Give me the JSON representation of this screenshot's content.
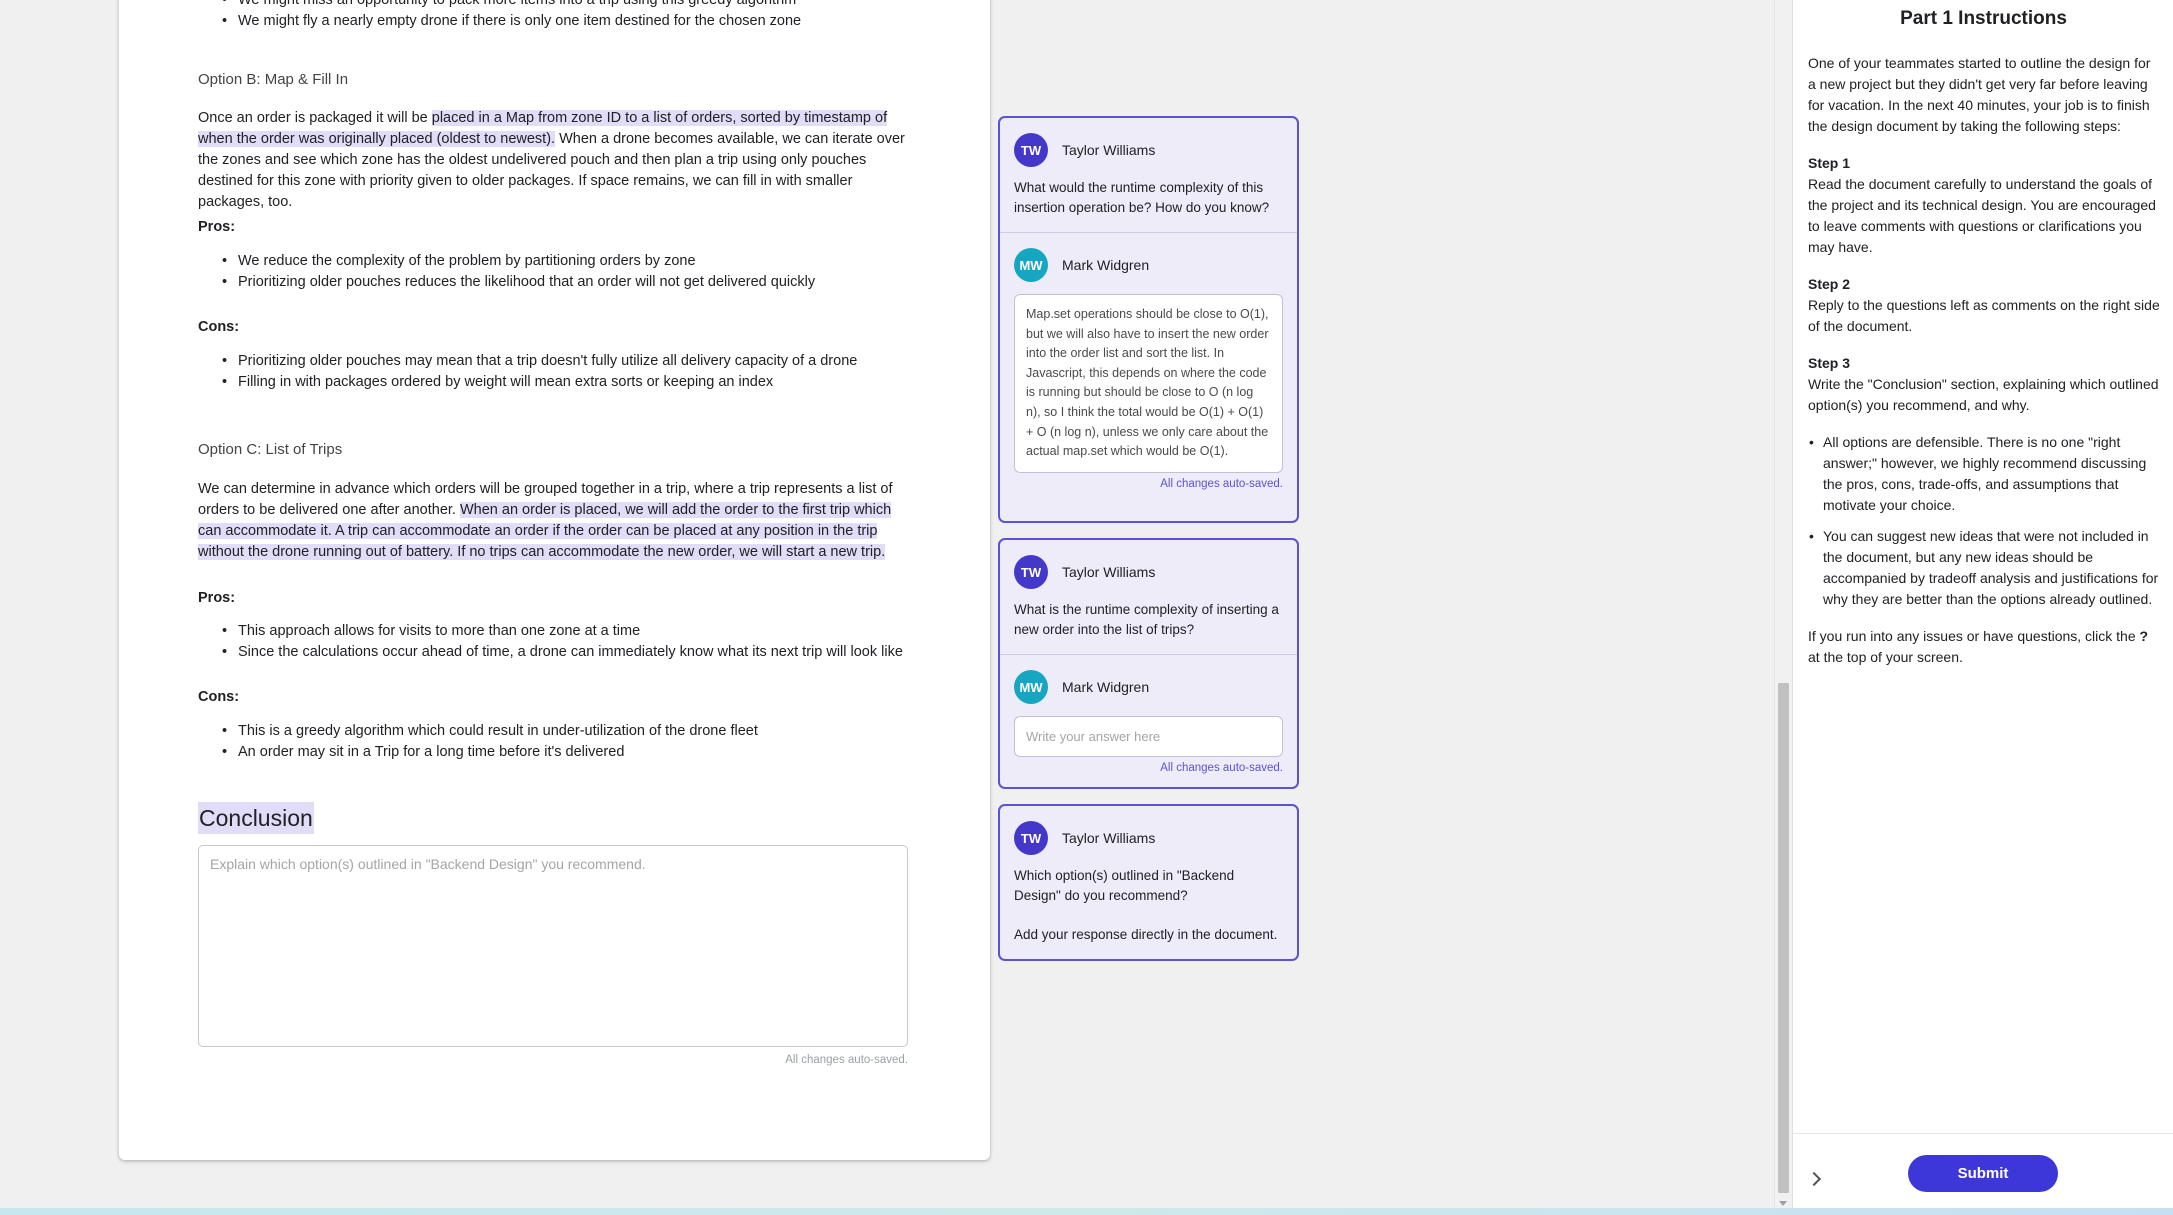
{
  "document": {
    "top_partial_line": "We might miss an opportunity to pack more items into a trip using this greedy algorithm",
    "top_bullet": "We might fly a nearly empty drone if there is only one item destined for the chosen zone",
    "option_b": {
      "title": "Option B: Map & Fill In",
      "para_pre": "Once an order is packaged it will be ",
      "para_hl": "placed in a Map from zone ID to a list of orders, sorted by timestamp of when the order was originally placed (oldest to newest).",
      "para_post": " When a drone becomes available, we can iterate over the zones and see which zone has the oldest undelivered pouch and then plan a trip using only pouches destined for this zone with priority given to older packages. If space remains, we can fill in with smaller packages, too.",
      "pros_label": "Pros:",
      "pros": [
        "We reduce the complexity of the problem by partitioning orders by zone",
        "Prioritizing older pouches reduces the likelihood that an order will not get delivered quickly"
      ],
      "cons_label": "Cons:",
      "cons": [
        "Prioritizing older pouches may mean that a trip doesn't fully utilize all delivery capacity of a drone",
        "Filling in with packages ordered by weight will mean extra sorts or keeping an index"
      ]
    },
    "option_c": {
      "title": "Option C: List of Trips",
      "para_pre": "We can determine in advance which orders will be grouped together in a trip, where a trip represents a list of orders to be delivered one after another. ",
      "para_hl": "When an order is placed, we will add the order to the first trip which can accommodate it. A trip can accommodate an order if the order can be placed at any position in the trip without the drone running out of battery. If no trips can accommodate the new order, we will start a new trip.",
      "pros_label": "Pros:",
      "pros": [
        "This approach allows for visits to more than one zone at a time",
        "Since the calculations occur ahead of time, a drone can immediately know what its next trip will look like"
      ],
      "cons_label": "Cons:",
      "cons": [
        "This is a greedy algorithm which could result in under-utilization of the drone fleet",
        "An order may sit in a Trip for a long time before it's delivered"
      ]
    },
    "conclusion": {
      "heading": "Conclusion",
      "placeholder": "Explain which option(s) outlined in \"Backend Design\" you recommend.",
      "autosave": "All changes auto-saved."
    }
  },
  "comments": [
    {
      "author_initials": "TW",
      "author": "Taylor Williams",
      "question": "What would the runtime complexity of this insertion operation be? How do you know?",
      "reply_initials": "MW",
      "reply_author": "Mark Widgren",
      "answer": "Map.set operations should be close to O(1), but we will also have to insert the new order into the order list and sort the list. In Javascript, this depends on where the code is running but should be close to O (n log n), so I think the total would be O(1) + O(1) + O (n log n), unless we only care about the actual map.set which would be O(1).",
      "autosave": "All changes auto-saved."
    },
    {
      "author_initials": "TW",
      "author": "Taylor Williams",
      "question": "What is the runtime complexity of inserting a new order into the list of trips?",
      "reply_initials": "MW",
      "reply_author": "Mark Widgren",
      "answer_placeholder": "Write your answer here",
      "autosave": "All changes auto-saved."
    },
    {
      "author_initials": "TW",
      "author": "Taylor Williams",
      "question": "Which option(s) outlined in \"Backend Design\" do you recommend?",
      "note": "Add your response directly in the document."
    }
  ],
  "instructions": {
    "title": "Part 1 Instructions",
    "intro": "One of your teammates started to outline the design for a new project but they didn't get very far before leaving for vacation. In the next 40 minutes, your job is to finish the design document by taking the following steps:",
    "step1_label": "Step 1",
    "step1": "Read the document carefully to understand the goals of the project and its technical design. You are encouraged to leave comments with questions or clarifications you may have.",
    "step2_label": "Step 2",
    "step2": "Reply to the questions left as comments on the right side of the document.",
    "step3_label": "Step 3",
    "step3": "Write the \"Conclusion\" section, explaining which outlined option(s) you recommend, and why.",
    "bullets": [
      "All options are defensible. There is no one \"right answer;\" however, we highly recommend discussing the pros, cons, trade-offs, and assumptions that motivate your choice.",
      "You can suggest new ideas that were not included in the document, but any new ideas should be accompanied by tradeoff analysis and justifications for why they are better than the options already outlined."
    ],
    "help_pre": "If you run into any issues or have questions, click the ",
    "help_icon": "?",
    "help_post": " at the top of your screen.",
    "submit_label": "Submit"
  },
  "icons": {
    "collapse": "chevron-right-icon",
    "scroll_down": "arrow-down-icon"
  },
  "colors": {
    "accent": "#3d36d8",
    "comment_bg": "#eeecf9",
    "highlight": "#e1dcf7",
    "avatar_tw": "#4338ca",
    "avatar_mw": "#16a6c1"
  }
}
